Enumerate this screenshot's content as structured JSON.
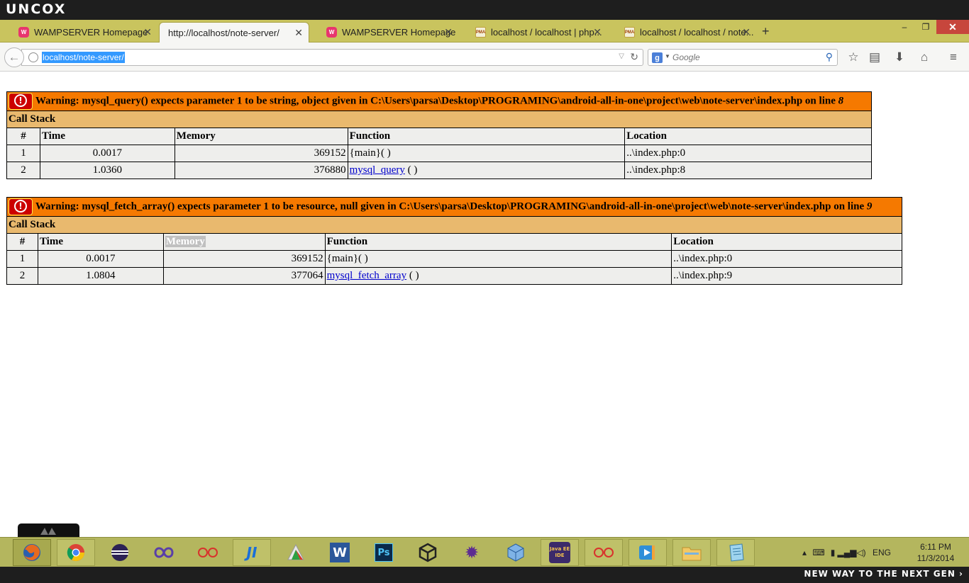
{
  "brand": {
    "logo": "UNCOX",
    "slogan": "NEW WAY TO THE NEXT GEN ›"
  },
  "tabs": [
    {
      "title": "WAMPSERVER Homepage",
      "icon": "wampserver-icon",
      "active": false
    },
    {
      "title": "http://localhost/note-server/",
      "icon": "none",
      "active": true
    },
    {
      "title": "WAMPSERVER Homepage",
      "icon": "wampserver-icon",
      "active": false
    },
    {
      "title": "localhost / localhost | php...",
      "icon": "phpmyadmin-icon",
      "active": false
    },
    {
      "title": "localhost / localhost / note...",
      "icon": "phpmyadmin-icon",
      "active": false
    }
  ],
  "tab_icon_text": {
    "wamp": "W",
    "pma": "PMA"
  },
  "window_controls": {
    "minimize": "–",
    "restore": "❐",
    "close": "✕"
  },
  "new_tab_label": "+",
  "navbar": {
    "url": "localhost/note-server/",
    "search_placeholder": "Google",
    "search_engine_letter": "g"
  },
  "errors": [
    {
      "message": "Warning: mysql_query() expects parameter 1 to be string, object given in C:\\Users\\parsa\\Desktop\\PROGRAMING\\android-all-in-one\\project\\web\\note-server\\index.php on line ",
      "line": "8",
      "callstack_label": "Call Stack",
      "headers": [
        "#",
        "Time",
        "Memory",
        "Function",
        "Location"
      ],
      "rows": [
        {
          "num": "1",
          "time": "0.0017",
          "memory": "369152",
          "function": "{main}( )",
          "link": "",
          "location": "..\\index.php:0"
        },
        {
          "num": "2",
          "time": "1.0360",
          "memory": "376880",
          "function": " ( )",
          "link": "mysql_query",
          "location": "..\\index.php:8"
        }
      ]
    },
    {
      "message": "Warning: mysql_fetch_array() expects parameter 1 to be resource, null given in C:\\Users\\parsa\\Desktop\\PROGRAMING\\android-all-in-one\\project\\web\\note-server\\index.php on line ",
      "line": "9",
      "callstack_label": "Call Stack",
      "headers": [
        "#",
        "Time",
        "Memory",
        "Function",
        "Location"
      ],
      "rows": [
        {
          "num": "1",
          "time": "0.0017",
          "memory": "369152",
          "function": "{main}( )",
          "link": "",
          "location": "..\\index.php:0"
        },
        {
          "num": "2",
          "time": "1.0804",
          "memory": "377064",
          "function": " ( )",
          "link": "mysql_fetch_array",
          "location": "..\\index.php:9"
        }
      ]
    }
  ],
  "taskbar": {
    "apps": [
      "firefox-icon",
      "chrome-icon",
      "eclipse-icon",
      "visual-studio-icon",
      "flickr-icon",
      "jetbrains-icon",
      "winrar-icon",
      "word-icon",
      "photoshop-icon",
      "unity-icon",
      "mathematica-icon",
      "virtualbox-icon",
      "java-ee-ide-icon",
      "flickr-icon",
      "media-player-icon",
      "file-explorer-icon",
      "notepad-icon"
    ],
    "icon_text": {
      "word": "W",
      "photoshop": "Ps",
      "jetbrains": "JI",
      "javaee": "Java EE IDE"
    },
    "tray": {
      "chevron": "▴",
      "language": "ENG"
    },
    "clock": {
      "time": "6:11 PM",
      "date": "11/3/2014"
    }
  },
  "colors": {
    "warning_header": "#f57900",
    "callstack_header": "#e9b96e",
    "table_cell": "#eeeeec",
    "taskbar": "#b4b65e",
    "tabstrip": "#c9c45e",
    "url_selection": "#3399ff"
  }
}
